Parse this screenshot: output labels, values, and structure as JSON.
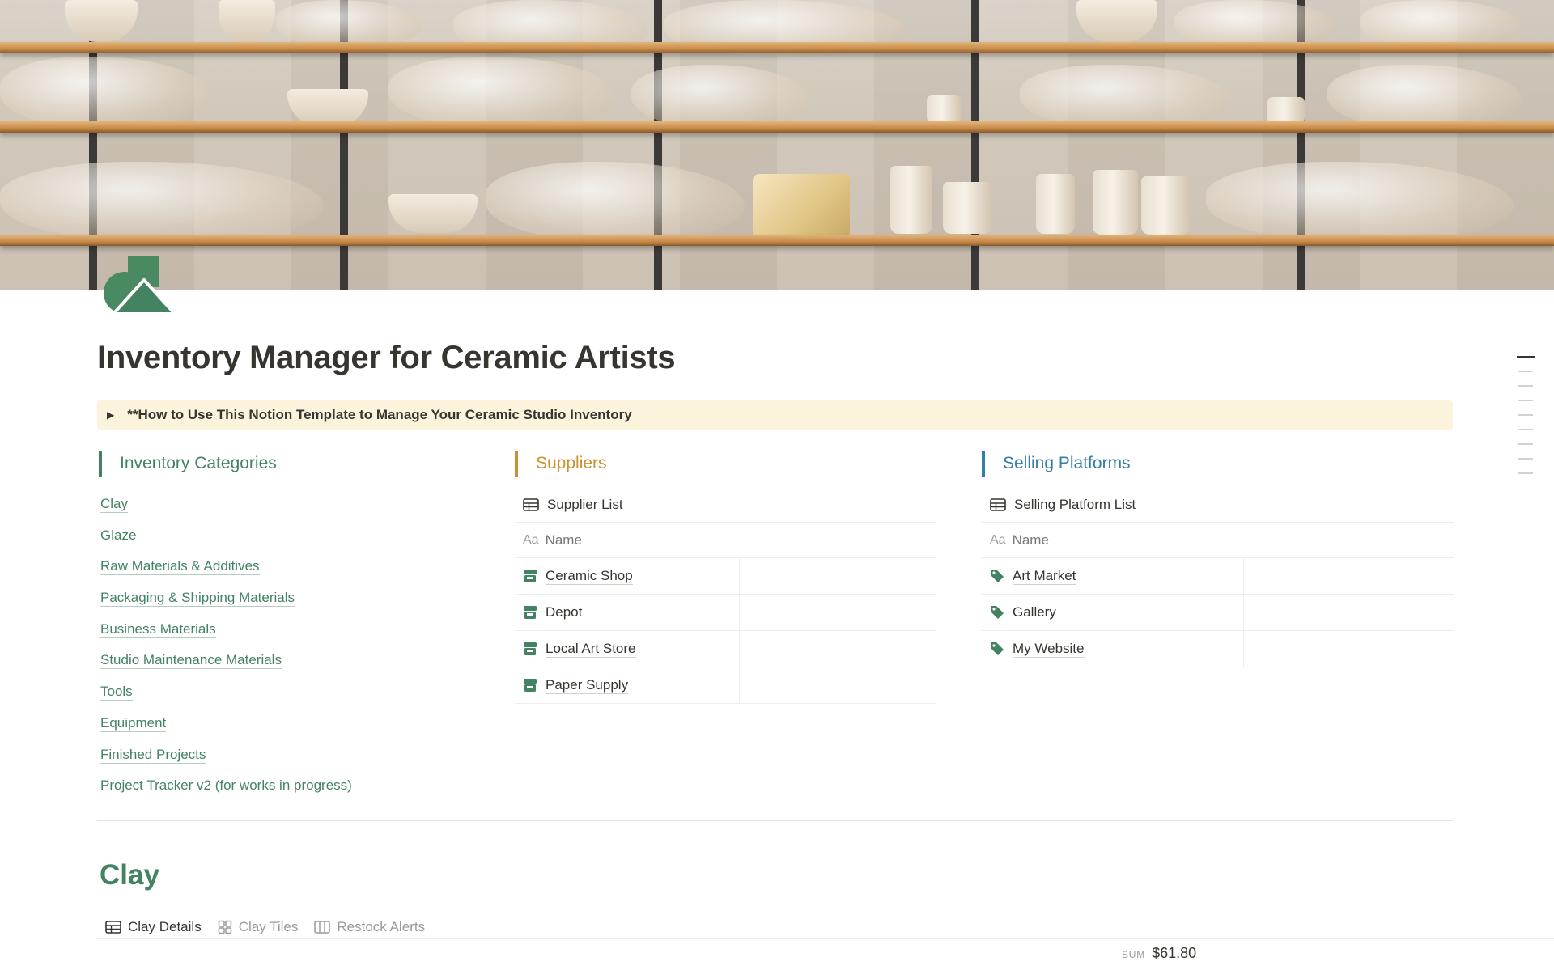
{
  "page": {
    "title": "Inventory Manager for Ceramic Artists",
    "icon": "shapes-icon",
    "cover": "ceramic-shelves-photo"
  },
  "callout": {
    "text": "**How to Use This Notion Template to Manage Your Ceramic Studio Inventory",
    "toggle_icon": "triangle-right-icon"
  },
  "columns": {
    "inventory": {
      "heading": "Inventory Categories",
      "color": "#448361",
      "links": [
        "Clay",
        "Glaze",
        "Raw Materials & Additives",
        "Packaging & Shipping Materials",
        "Business Materials",
        "Studio Maintenance Materials",
        "Tools",
        "Equipment",
        "Finished Projects",
        "Project Tracker v2 (for works in progress)"
      ]
    },
    "suppliers": {
      "heading": "Suppliers",
      "color": "#cb912f",
      "db_title": "Supplier List",
      "name_header": "Name",
      "name_header_icon": "Aa",
      "rows": [
        "Ceramic Shop",
        "Depot",
        "Local Art Store",
        "Paper Supply"
      ]
    },
    "platforms": {
      "heading": "Selling Platforms",
      "color": "#337ea9",
      "db_title": "Selling Platform List",
      "name_header": "Name",
      "name_header_icon": "Aa",
      "rows": [
        "Art Market",
        "Gallery",
        "My Website"
      ]
    }
  },
  "clay_section": {
    "title": "Clay",
    "tabs": [
      "Clay Details",
      "Clay Tiles",
      "Restock Alerts"
    ],
    "active_tab": "Clay Details",
    "sum_label": "SUM",
    "sum_value": "$61.80"
  },
  "colors": {
    "accent_green": "#448361",
    "callout_bg": "#fbf3db",
    "text": "#37352f"
  }
}
